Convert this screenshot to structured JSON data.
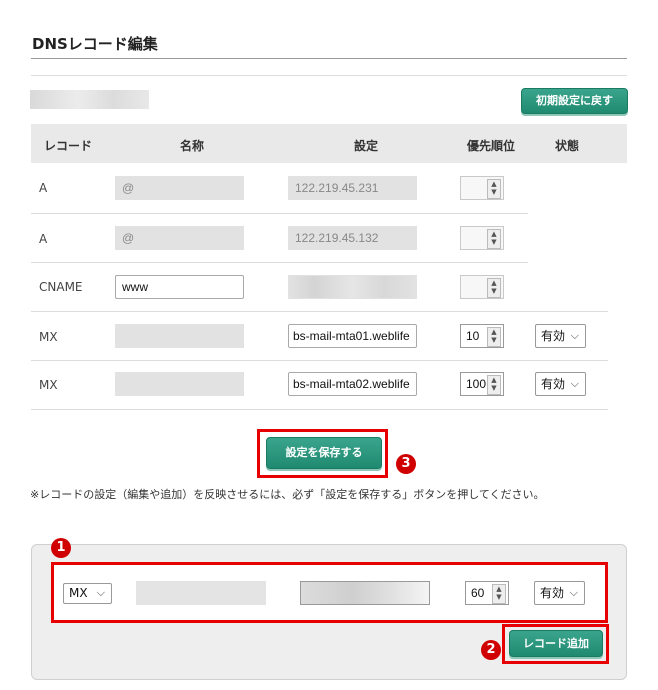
{
  "header": {
    "title": "DNSレコード編集"
  },
  "toolbar": {
    "reset_label": "初期設定に戻す"
  },
  "table": {
    "headers": {
      "record": "レコード",
      "name": "名称",
      "setting": "設定",
      "priority": "優先順位",
      "status": "状態"
    },
    "rows": [
      {
        "type": "A",
        "name": "@",
        "value": "122.219.45.231",
        "priority": "",
        "status": ""
      },
      {
        "type": "A",
        "name": "@",
        "value": "122.219.45.132",
        "priority": "",
        "status": ""
      },
      {
        "type": "CNAME",
        "name": "www",
        "value": "",
        "priority": "",
        "status": ""
      },
      {
        "type": "MX",
        "name": "",
        "value": "bs-mail-mta01.weblife",
        "priority": "10",
        "status": "有効"
      },
      {
        "type": "MX",
        "name": "",
        "value": "bs-mail-mta02.weblife",
        "priority": "100",
        "status": "有効"
      }
    ]
  },
  "save": {
    "label": "設定を保存する"
  },
  "note": "※レコードの設定（編集や追加）を反映させるには、必ず「設定を保存する」ボタンを押してください。",
  "add_form": {
    "type": "MX",
    "priority": "60",
    "status": "有効",
    "add_label": "レコード追加"
  },
  "annotations": {
    "one": "1",
    "two": "2",
    "three": "3"
  },
  "colors": {
    "accent": "#1f8a70",
    "highlight": "#e60000",
    "badge": "#d00000"
  },
  "icons": {
    "spinner": "spinner-arrows-icon",
    "dropdown": "chevron-down-icon"
  }
}
